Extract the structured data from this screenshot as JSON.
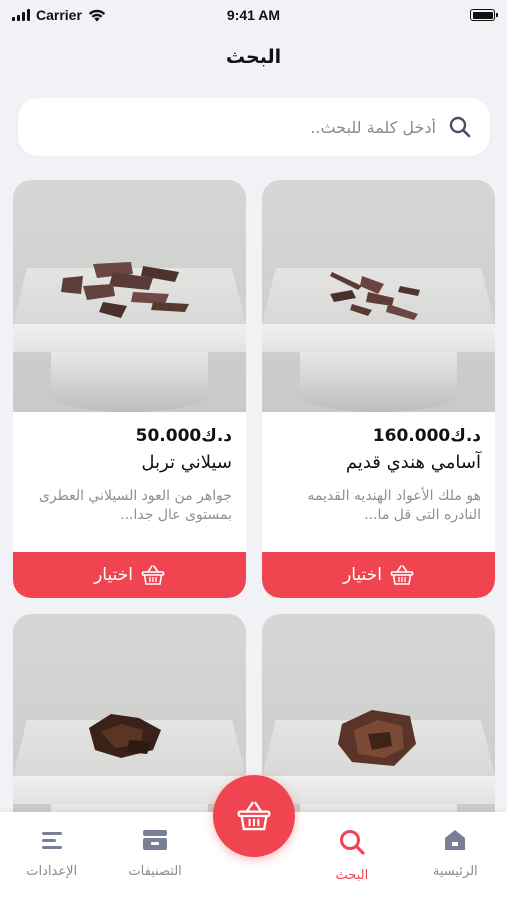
{
  "status_bar": {
    "carrier": "Carrier",
    "time": "9:41 AM",
    "battery_level": 1.0
  },
  "header": {
    "title": "البحث"
  },
  "search": {
    "placeholder": "أدخل كلمة للبحث..",
    "value": "",
    "icon": "search-icon"
  },
  "products": [
    {
      "price": "160.000د.ك",
      "name": "آسامي هندي قديم",
      "description": "هو ملك الأعواد الهنديه القديمه النادره التى قل ما...",
      "button_label": "اختيار",
      "button_icon": "basket-icon"
    },
    {
      "price": "50.000د.ك",
      "name": "سيلاني تربل",
      "description": "جواهر من العود السيلاني العطرى بمستوى عال جدا...",
      "button_label": "اختيار",
      "button_icon": "basket-icon"
    }
  ],
  "bottom_nav": {
    "items": [
      {
        "label": "الرئيسية",
        "icon": "home-icon",
        "active": false
      },
      {
        "label": "البحث",
        "icon": "search-icon",
        "active": true
      },
      {
        "label": "التصنيفات",
        "icon": "categories-icon",
        "active": false
      },
      {
        "label": "الإعدادات",
        "icon": "settings-icon",
        "active": false
      }
    ],
    "fab_icon": "basket-icon"
  },
  "colors": {
    "accent": "#f04550",
    "background": "#f1f2f6",
    "muted_text": "#8e8e95"
  }
}
